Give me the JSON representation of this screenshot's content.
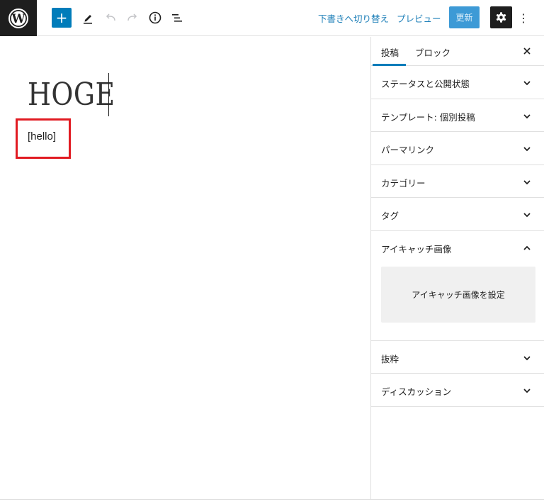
{
  "toolbar": {
    "add_label": "+",
    "switch_to_draft": "下書きへ切り替え",
    "preview": "プレビュー",
    "update": "更新",
    "more_label": "⋮"
  },
  "editor": {
    "title": "HOGE",
    "shortcode": "[hello]"
  },
  "sidebar": {
    "tabs": [
      {
        "label": "投稿",
        "active": true
      },
      {
        "label": "ブロック",
        "active": false
      }
    ],
    "panels": [
      {
        "label": "ステータスと公開状態",
        "open": false
      },
      {
        "label": "テンプレート: 個別投稿",
        "open": false
      },
      {
        "label": "パーマリンク",
        "open": false
      },
      {
        "label": "カテゴリー",
        "open": false
      },
      {
        "label": "タグ",
        "open": false
      },
      {
        "label": "アイキャッチ画像",
        "open": true,
        "button": "アイキャッチ画像を設定"
      },
      {
        "label": "抜粋",
        "open": false
      },
      {
        "label": "ディスカッション",
        "open": false
      }
    ]
  },
  "colors": {
    "accent": "#007cba",
    "highlight_box": "#e11b22",
    "dark": "#1e1e1e"
  },
  "icons": [
    "wordpress-logo-icon",
    "plus-icon",
    "pencil-icon",
    "undo-icon",
    "redo-icon",
    "info-icon",
    "list-view-icon",
    "gear-icon",
    "more-vertical-icon",
    "close-icon",
    "chevron-down-icon",
    "chevron-up-icon"
  ]
}
